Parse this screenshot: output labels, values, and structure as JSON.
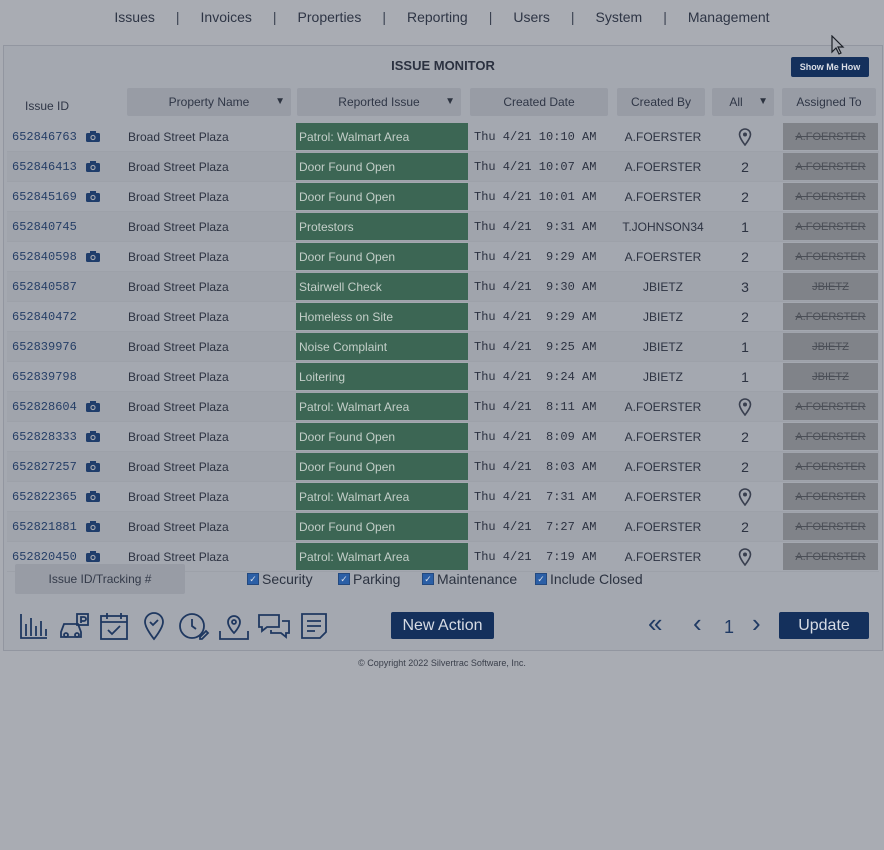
{
  "nav": [
    "Issues",
    "Invoices",
    "Properties",
    "Reporting",
    "Users",
    "System",
    "Management"
  ],
  "panel": {
    "title": "ISSUE MONITOR",
    "show_me": "Show Me How"
  },
  "headers": {
    "issue_id": "Issue ID",
    "property": "Property Name",
    "reported": "Reported Issue",
    "created_date": "Created Date",
    "created_by": "Created By",
    "count_filter": "All",
    "assigned": "Assigned To"
  },
  "rows": [
    {
      "id": "652846763",
      "cam": true,
      "property": "Broad Street Plaza",
      "issue": "Patrol: Walmart Area",
      "date": "Thu 4/21 10:10 AM",
      "by": "A.FOERSTER",
      "count": "pin",
      "assigned": "A.FOERSTER"
    },
    {
      "id": "652846413",
      "cam": true,
      "property": "Broad Street Plaza",
      "issue": "Door Found Open",
      "date": "Thu 4/21 10:07 AM",
      "by": "A.FOERSTER",
      "count": "2",
      "assigned": "A.FOERSTER"
    },
    {
      "id": "652845169",
      "cam": true,
      "property": "Broad Street Plaza",
      "issue": "Door Found Open",
      "date": "Thu 4/21 10:01 AM",
      "by": "A.FOERSTER",
      "count": "2",
      "assigned": "A.FOERSTER"
    },
    {
      "id": "652840745",
      "cam": false,
      "property": "Broad Street Plaza",
      "issue": "Protestors",
      "date": "Thu 4/21  9:31 AM",
      "by": "T.JOHNSON34",
      "count": "1",
      "assigned": "A.FOERSTER"
    },
    {
      "id": "652840598",
      "cam": true,
      "property": "Broad Street Plaza",
      "issue": "Door Found Open",
      "date": "Thu 4/21  9:29 AM",
      "by": "A.FOERSTER",
      "count": "2",
      "assigned": "A.FOERSTER"
    },
    {
      "id": "652840587",
      "cam": false,
      "property": "Broad Street Plaza",
      "issue": "Stairwell Check",
      "date": "Thu 4/21  9:30 AM",
      "by": "JBIETZ",
      "count": "3",
      "assigned": "JBIETZ"
    },
    {
      "id": "652840472",
      "cam": false,
      "property": "Broad Street Plaza",
      "issue": "Homeless on Site",
      "date": "Thu 4/21  9:29 AM",
      "by": "JBIETZ",
      "count": "2",
      "assigned": "A.FOERSTER"
    },
    {
      "id": "652839976",
      "cam": false,
      "property": "Broad Street Plaza",
      "issue": "Noise Complaint",
      "date": "Thu 4/21  9:25 AM",
      "by": "JBIETZ",
      "count": "1",
      "assigned": "JBIETZ"
    },
    {
      "id": "652839798",
      "cam": false,
      "property": "Broad Street Plaza",
      "issue": "Loitering",
      "date": "Thu 4/21  9:24 AM",
      "by": "JBIETZ",
      "count": "1",
      "assigned": "JBIETZ"
    },
    {
      "id": "652828604",
      "cam": true,
      "property": "Broad Street Plaza",
      "issue": "Patrol: Walmart Area",
      "date": "Thu 4/21  8:11 AM",
      "by": "A.FOERSTER",
      "count": "pin",
      "assigned": "A.FOERSTER"
    },
    {
      "id": "652828333",
      "cam": true,
      "property": "Broad Street Plaza",
      "issue": "Door Found Open",
      "date": "Thu 4/21  8:09 AM",
      "by": "A.FOERSTER",
      "count": "2",
      "assigned": "A.FOERSTER"
    },
    {
      "id": "652827257",
      "cam": true,
      "property": "Broad Street Plaza",
      "issue": "Door Found Open",
      "date": "Thu 4/21  8:03 AM",
      "by": "A.FOERSTER",
      "count": "2",
      "assigned": "A.FOERSTER"
    },
    {
      "id": "652822365",
      "cam": true,
      "property": "Broad Street Plaza",
      "issue": "Patrol: Walmart Area",
      "date": "Thu 4/21  7:31 AM",
      "by": "A.FOERSTER",
      "count": "pin",
      "assigned": "A.FOERSTER"
    },
    {
      "id": "652821881",
      "cam": true,
      "property": "Broad Street Plaza",
      "issue": "Door Found Open",
      "date": "Thu 4/21  7:27 AM",
      "by": "A.FOERSTER",
      "count": "2",
      "assigned": "A.FOERSTER"
    },
    {
      "id": "652820450",
      "cam": true,
      "property": "Broad Street Plaza",
      "issue": "Patrol: Walmart Area",
      "date": "Thu 4/21  7:19 AM",
      "by": "A.FOERSTER",
      "count": "pin",
      "assigned": "A.FOERSTER"
    }
  ],
  "filters": {
    "tracking_placeholder": "Issue ID/Tracking #",
    "security": "Security",
    "parking": "Parking",
    "maintenance": "Maintenance",
    "include_closed": "Include Closed"
  },
  "toolbar": {
    "icons": [
      "bar-chart-icon",
      "parking-car-icon",
      "calendar-check-icon",
      "location-pin-icon",
      "clock-edit-icon",
      "map-pin-icon",
      "chat-bubbles-icon",
      "notes-icon"
    ],
    "new_action": "New Action",
    "first": "«",
    "prev": "‹",
    "page": "1",
    "next": "›",
    "update": "Update"
  },
  "footer": "© Copyright 2022 Silvertrac Software, Inc."
}
